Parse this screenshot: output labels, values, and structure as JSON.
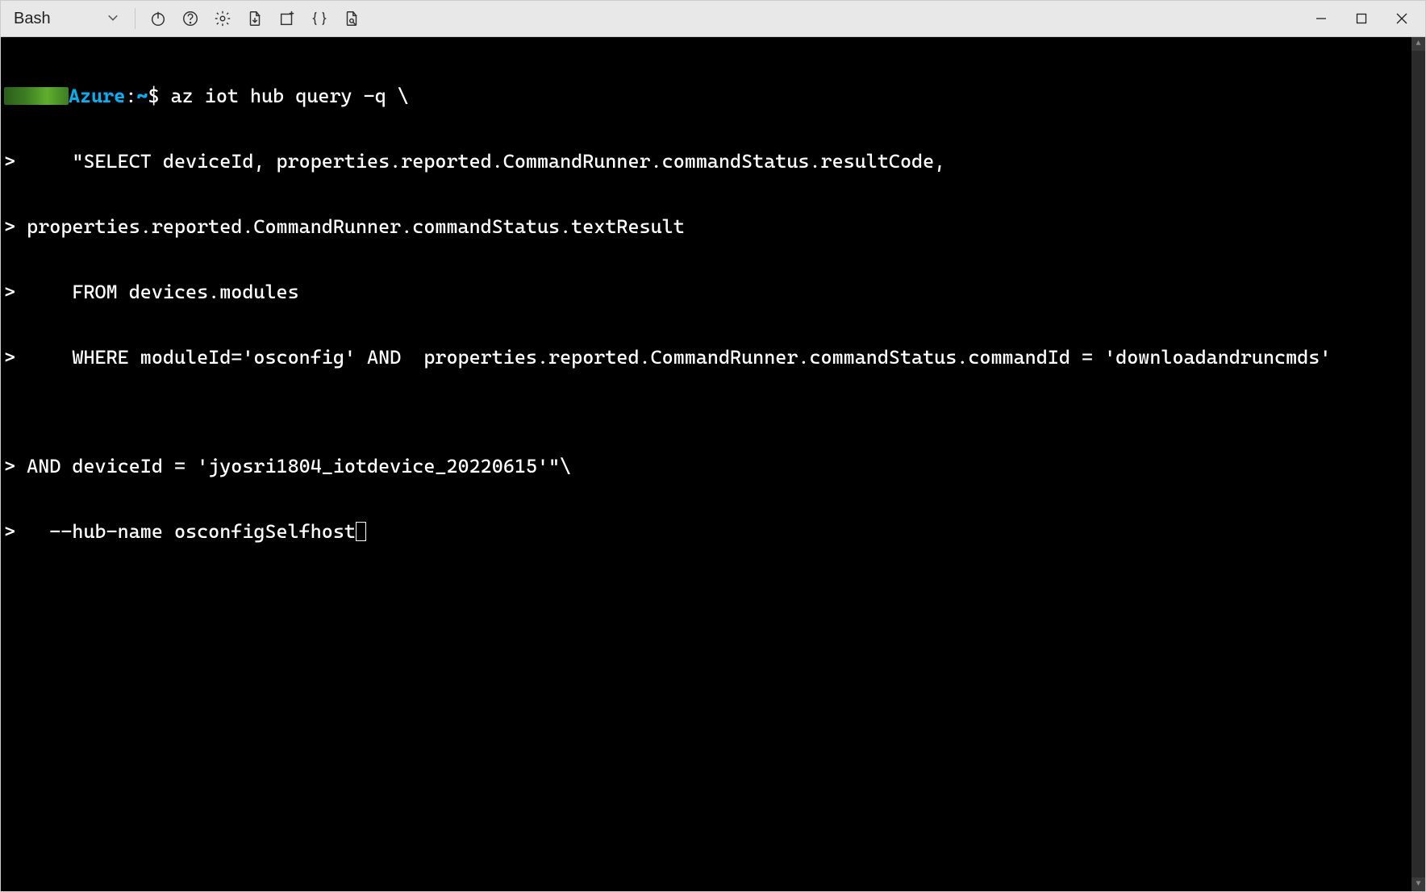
{
  "toolbar": {
    "shell_label": "Bash"
  },
  "terminal": {
    "prompt_host": "Azure",
    "prompt_sep": ":",
    "prompt_path": "~",
    "prompt_sym": "$",
    "lines": {
      "l0_cmd": " az iot hub query -q \\",
      "l1": ">     \"SELECT deviceId, properties.reported.CommandRunner.commandStatus.resultCode,",
      "l2": "> properties.reported.CommandRunner.commandStatus.textResult",
      "l3": ">     FROM devices.modules",
      "l4": ">     WHERE moduleId='osconfig' AND  properties.reported.CommandRunner.commandStatus.commandId = 'downloadandruncmds'",
      "l5": "",
      "l6": "> AND deviceId = 'jyosri1804_iotdevice_20220615'\"\\",
      "l7_a": ">   --hub-name osconfigSelfhost"
    }
  }
}
